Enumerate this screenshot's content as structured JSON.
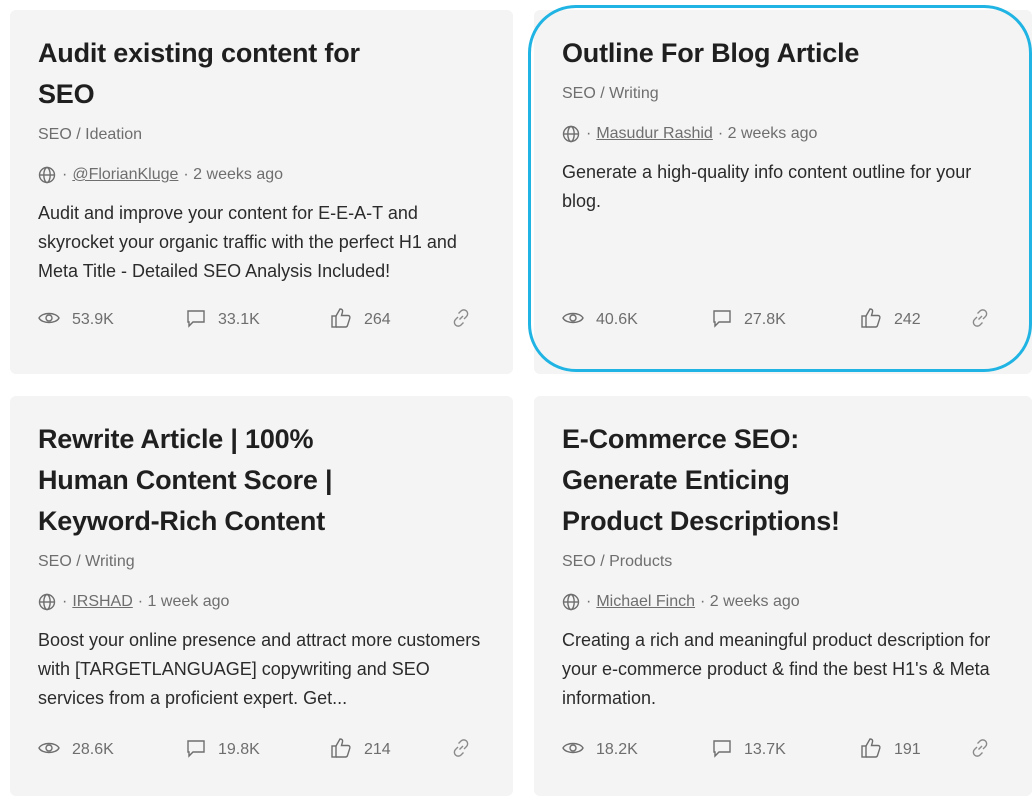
{
  "cards": [
    {
      "title": "Audit existing content for SEO",
      "category": "SEO / Ideation",
      "meta_sep": "·",
      "author": "@FlorianKluge",
      "time": "· 2 weeks ago",
      "description": "Audit and improve your content for E-E-A-T and skyrocket your organic traffic with the perfect H1 and Meta Title - Detailed SEO Analysis Included!",
      "views": "53.9K",
      "comments": "33.1K",
      "likes": "264"
    },
    {
      "title": "Outline For Blog Article",
      "category": "SEO / Writing",
      "meta_sep": "·",
      "author": "Masudur Rashid",
      "time": "· 2 weeks ago",
      "description": "Generate a high-quality info content outline for your blog.",
      "views": "40.6K",
      "comments": "27.8K",
      "likes": "242"
    },
    {
      "title": "Rewrite Article | 100% Human Content Score | Keyword-Rich Content",
      "category": "SEO / Writing",
      "meta_sep": "·",
      "author": "IRSHAD",
      "time": "· 1 week ago",
      "description": "Boost your online presence and attract more customers with [TARGETLANGUAGE] copywriting and SEO services from a proficient expert. Get...",
      "views": "28.6K",
      "comments": "19.8K",
      "likes": "214"
    },
    {
      "title": "E-Commerce SEO: Generate Enticing Product Descriptions!",
      "category": "SEO / Products",
      "meta_sep": "·",
      "author": "Michael Finch",
      "time": "· 2 weeks ago",
      "description": "Creating a rich and meaningful product description for your e-commerce product & find the best H1's & Meta information.",
      "views": "18.2K",
      "comments": "13.7K",
      "likes": "191"
    }
  ],
  "colors": {
    "card_background": "#f4f4f4",
    "highlight_ring": "#1fb4e3",
    "muted_text": "#6e6e6e"
  },
  "icons": [
    "globe-icon",
    "eye-icon",
    "comment-icon",
    "thumbs-up-icon",
    "link-icon"
  ]
}
